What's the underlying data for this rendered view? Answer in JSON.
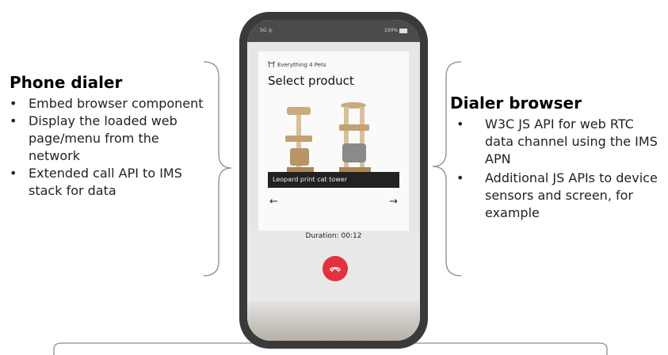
{
  "left_panel": {
    "title": "Phone dialer",
    "bullet_symbol": "•",
    "items": [
      "Embed browser component",
      "Display the loaded web page/menu from the network",
      "Extended call API to IMS stack for data"
    ]
  },
  "right_panel": {
    "title": "Dialer browser",
    "bullet_symbol": "•",
    "items": [
      "W3C JS API for web RTC data channel using the IMS APN",
      "Additional JS APIs to device sensors and screen, for example"
    ]
  },
  "phone": {
    "status_left": "5G ◎",
    "status_right": "100%",
    "brand": "Everything 4 Pets",
    "page_heading": "Select product",
    "product_caption": "Leopard print cat tower",
    "prev_arrow": "←",
    "next_arrow": "→",
    "duration": "Duration: 00:12"
  },
  "colors": {
    "phone_frame": "#3a3a3a",
    "hangup": "#e4313f",
    "brace_stroke": "#8c8c8c"
  },
  "icons": [
    "cat-icon",
    "battery-icon",
    "phone-hangup-icon",
    "arrow-left-icon",
    "arrow-right-icon"
  ]
}
